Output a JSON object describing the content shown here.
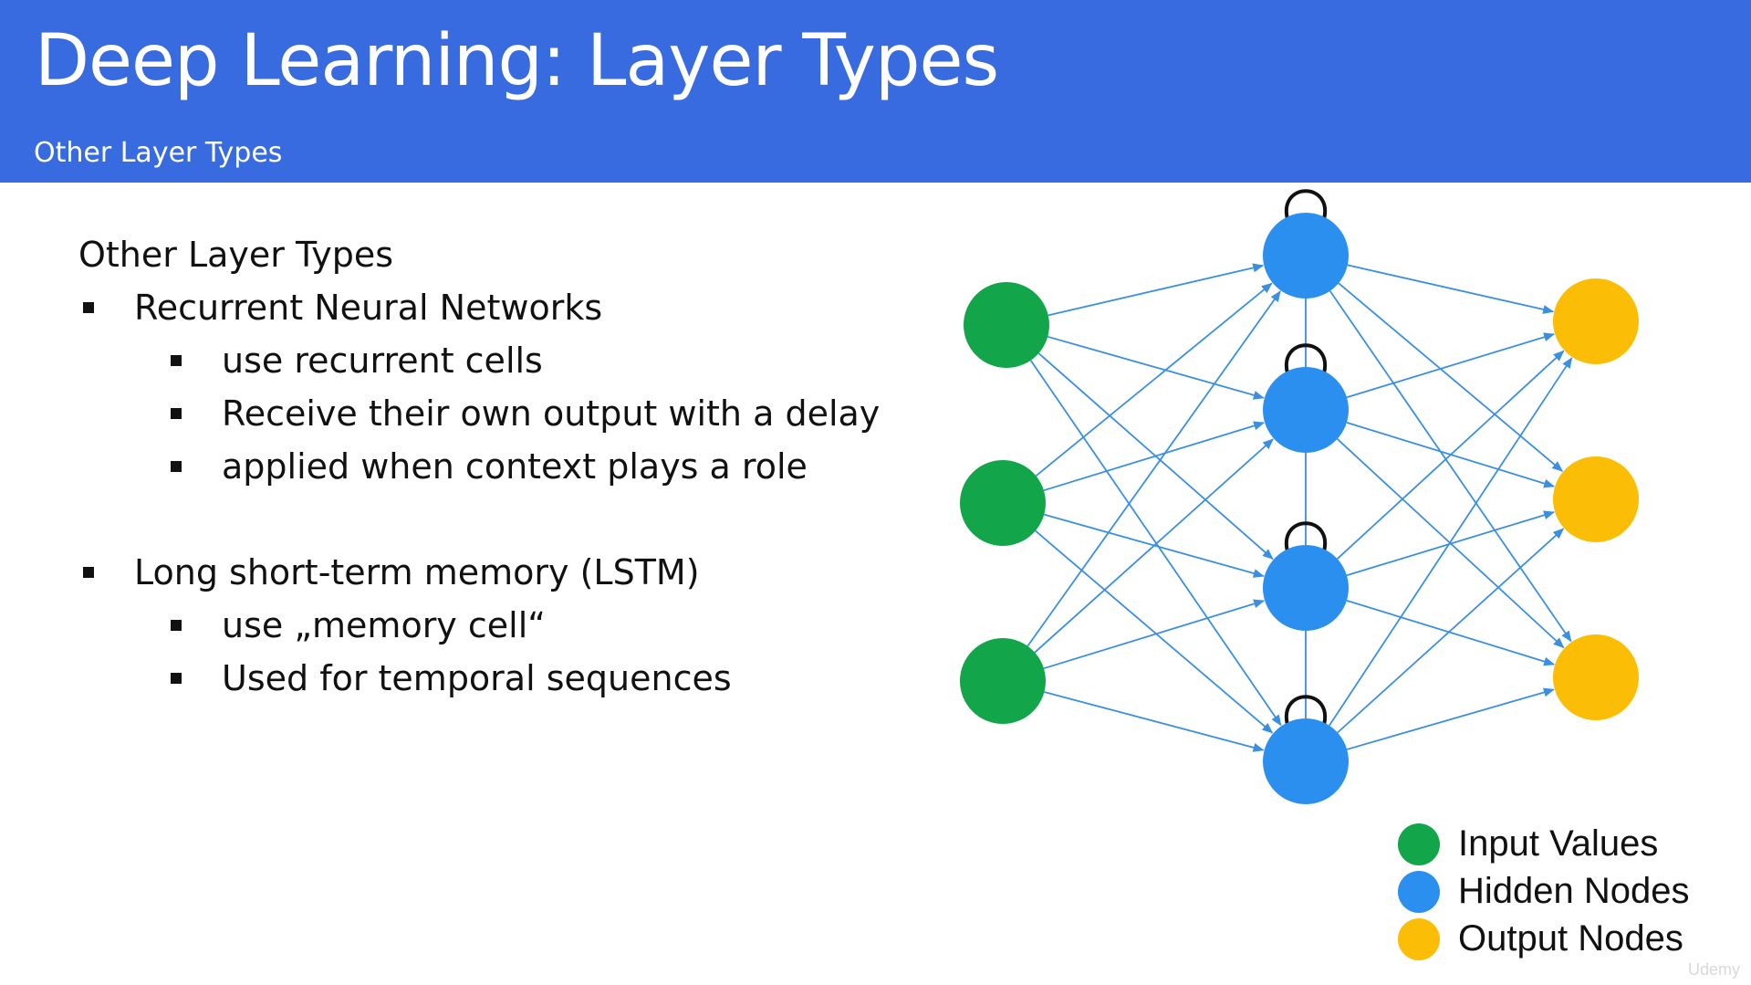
{
  "slide": {
    "title": "Deep Learning: Layer Types",
    "subtitle": "Other Layer Types",
    "header_color": "#386ae0"
  },
  "content": {
    "heading": "Other Layer Types",
    "sections": [
      {
        "label": "Recurrent Neural Networks",
        "subitems": [
          "use recurrent cells",
          "Receive their own output with a delay",
          "applied when context plays a role"
        ]
      },
      {
        "label": "Long short-term memory (LSTM)",
        "subitems": [
          "use „memory cell“",
          "Used for temporal sequences"
        ]
      }
    ]
  },
  "diagram": {
    "colors": {
      "input": "#12a54a",
      "hidden": "#2b8ff0",
      "output": "#fbbd05",
      "edge": "#3a8fe3",
      "loop": "#111111"
    },
    "layers": {
      "input": 3,
      "hidden": 4,
      "output": 3
    },
    "connections": "fully-connected",
    "hidden_self_loops": true,
    "hidden_vertical_links": true
  },
  "legend": {
    "items": [
      {
        "label": "Input Values",
        "color": "#12a54a"
      },
      {
        "label": "Hidden Nodes",
        "color": "#2b8ff0"
      },
      {
        "label": "Output Nodes",
        "color": "#fbbd05"
      }
    ]
  },
  "watermark": "Udemy"
}
